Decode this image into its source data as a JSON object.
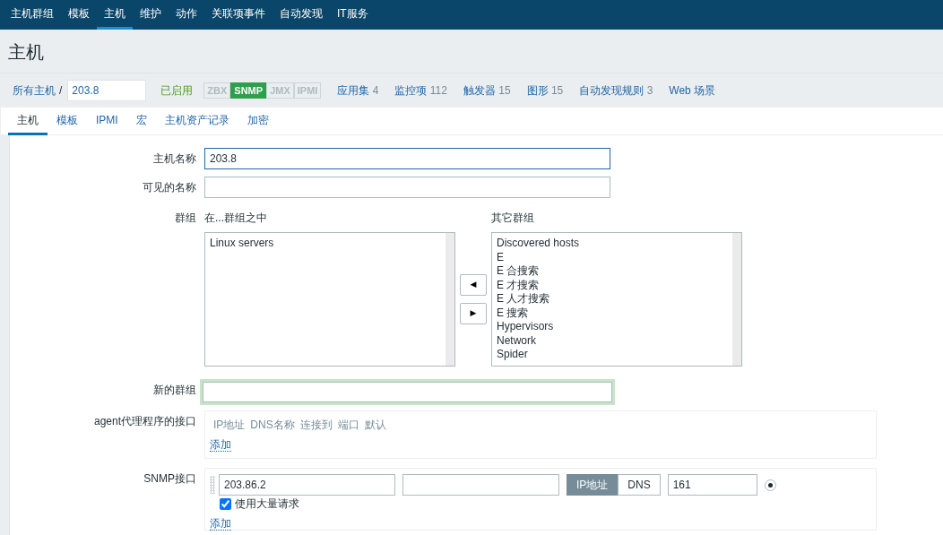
{
  "top_menu": [
    {
      "label": "主机群组",
      "selected": false
    },
    {
      "label": "模板",
      "selected": false
    },
    {
      "label": "主机",
      "selected": true
    },
    {
      "label": "维护",
      "selected": false
    },
    {
      "label": "动作",
      "selected": false
    },
    {
      "label": "关联项事件",
      "selected": false
    },
    {
      "label": "自动发现",
      "selected": false
    },
    {
      "label": "IT服务",
      "selected": false
    }
  ],
  "page_title": "主机",
  "breadcrumb": {
    "root": "所有主机",
    "separator": "/",
    "current": "203.8"
  },
  "host_status": "已启用",
  "availability": [
    {
      "label": "ZBX",
      "on": false
    },
    {
      "label": "SNMP",
      "on": true
    },
    {
      "label": "JMX",
      "on": false
    },
    {
      "label": "IPMI",
      "on": false
    }
  ],
  "host_links": [
    {
      "label": "应用集",
      "count": "4"
    },
    {
      "label": "监控项",
      "count": "112"
    },
    {
      "label": "触发器",
      "count": "15"
    },
    {
      "label": "图形",
      "count": "15"
    },
    {
      "label": "自动发现规则",
      "count": "3"
    },
    {
      "label": "Web 场景"
    }
  ],
  "tabs": [
    {
      "label": "主机",
      "selected": true
    },
    {
      "label": "模板",
      "selected": false
    },
    {
      "label": "IPMI",
      "selected": false
    },
    {
      "label": "宏",
      "selected": false
    },
    {
      "label": "主机资产记录",
      "selected": false
    },
    {
      "label": "加密",
      "selected": false
    }
  ],
  "form": {
    "host_name": {
      "label": "主机名称",
      "value": "203.8"
    },
    "visible_name": {
      "label": "可见的名称"
    },
    "groups": {
      "label": "群组",
      "in_groups_title": "在...群组之中",
      "in_groups": [
        "Linux servers"
      ],
      "move_left": "◀",
      "move_right": "▶",
      "other_groups_title": "其它群组",
      "other_groups": [
        "Discovered hosts",
        "E",
        "E 合搜索",
        "E 才搜索",
        "E 人才搜索",
        "E 搜索",
        "Hypervisors",
        "Network",
        "Spider"
      ]
    },
    "new_group": {
      "label": "新的群组"
    },
    "agent_interfaces": {
      "label": "agent代理程序的接口",
      "columns": [
        "IP地址",
        "DNS名称",
        "连接到",
        "端口",
        "默认"
      ],
      "add": "添加"
    },
    "snmp_interfaces": {
      "label": "SNMP接口",
      "rows": [
        {
          "ip": "203.86.2",
          "connect": [
            {
              "label": "IP地址",
              "selected": true
            },
            {
              "label": "DNS",
              "selected": false
            }
          ],
          "port": "161",
          "default": true,
          "bulk": {
            "label": "使用大量请求",
            "checked": true
          }
        }
      ],
      "add": "添加"
    }
  }
}
